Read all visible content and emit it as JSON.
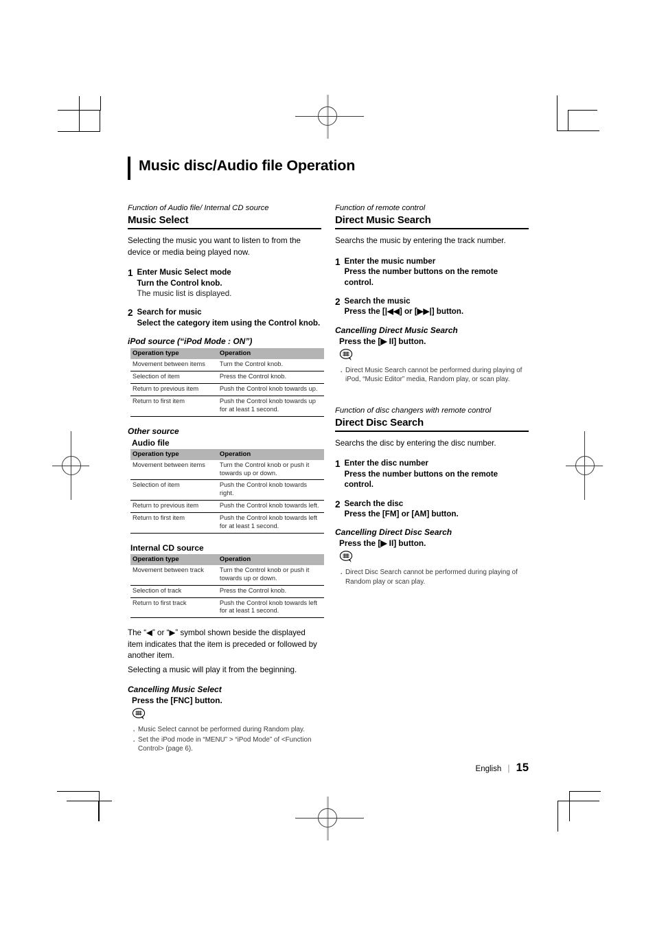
{
  "document": {
    "page_title": "Music disc/Audio file Operation",
    "footer": {
      "language": "English",
      "separator": "|",
      "page_number": "15"
    }
  },
  "colors": {
    "table_header_bg": "#b4b4b4",
    "rule": "#000000",
    "note_text": "#3a3a3a"
  },
  "left_column": {
    "kicker": "Function of Audio file/ Internal CD source",
    "heading": "Music Select",
    "intro": "Selecting the music you want to listen to from the device or media being played now.",
    "steps": [
      {
        "num": "1",
        "title": "Enter Music Select mode",
        "bold_line": "Turn the Control knob.",
        "note": "The music list is displayed."
      },
      {
        "num": "2",
        "title": "Search for music",
        "bold_line": "Select the category item using the Control knob.",
        "note": ""
      }
    ],
    "tables": [
      {
        "caption_italic": "iPod source (“iPod Mode : ON”)",
        "caption_bold": "",
        "headers": [
          "Operation type",
          "Operation"
        ],
        "rows": [
          [
            "Movement between items",
            "Turn the Control knob."
          ],
          [
            "Selection of item",
            "Press the Control knob."
          ],
          [
            "Return to previous item",
            "Push the Control knob towards up."
          ],
          [
            "Return to first item",
            "Push the Control knob towards up for at least 1 second."
          ]
        ]
      },
      {
        "caption_italic": "Other source",
        "caption_bold": "Audio file",
        "headers": [
          "Operation type",
          "Operation"
        ],
        "rows": [
          [
            "Movement between items",
            "Turn the Control knob or push it towards up or down."
          ],
          [
            "Selection of item",
            "Push the Control knob towards right."
          ],
          [
            "Return to previous item",
            "Push the Control knob towards left."
          ],
          [
            "Return to first item",
            "Push the Control knob towards left for at least 1 second."
          ]
        ]
      },
      {
        "caption_italic": "",
        "caption_bold": "Internal CD source",
        "headers": [
          "Operation type",
          "Operation"
        ],
        "rows": [
          [
            "Movement between track",
            "Turn the Control knob or push it towards up or down."
          ],
          [
            "Selection of track",
            "Press the Control knob."
          ],
          [
            "Return to first track",
            "Push the Control knob towards left for at least 1 second."
          ]
        ]
      }
    ],
    "after_tables": {
      "paragraph_1": "The “◀” or “▶” symbol shown beside the displayed item indicates that the item is preceded or followed by another item.",
      "paragraph_2": "Selecting a music will play it from the beginning."
    },
    "cancelling": {
      "heading": "Cancelling Music Select",
      "action": "Press the [FNC] button.",
      "notes": [
        "Music Select cannot be performed during Random play.",
        "Set the iPod mode in “MENU” > “iPod Mode” of <Function Control> (page 6)."
      ]
    }
  },
  "right_column": {
    "sections": [
      {
        "kicker": "Function of remote control",
        "heading": "Direct Music Search",
        "intro": "Searchs the music by entering the track number.",
        "steps": [
          {
            "num": "1",
            "title": "Enter the music number",
            "bold_line": "Press the number buttons on the remote control."
          },
          {
            "num": "2",
            "title": "Search the music",
            "bold_line": "Press the [|◀◀] or [▶▶|] button."
          }
        ],
        "cancelling": {
          "heading": "Cancelling Direct Music Search",
          "action": "Press the [▶ II] button.",
          "notes": [
            "Direct Music Search cannot be performed during playing of iPod, “Music Editor” media, Random play, or scan play."
          ]
        }
      },
      {
        "kicker": "Function of disc changers with remote control",
        "heading": "Direct Disc Search",
        "intro": "Searchs the disc by entering the disc number.",
        "steps": [
          {
            "num": "1",
            "title": "Enter the disc number",
            "bold_line": "Press the number buttons on the remote control."
          },
          {
            "num": "2",
            "title": "Search the disc",
            "bold_line": "Press the [FM] or [AM] button."
          }
        ],
        "cancelling": {
          "heading": "Cancelling Direct Disc Search",
          "action": "Press the [▶ II] button.",
          "notes": [
            "Direct Disc Search cannot be performed during playing of Random play or scan play."
          ]
        }
      }
    ]
  }
}
